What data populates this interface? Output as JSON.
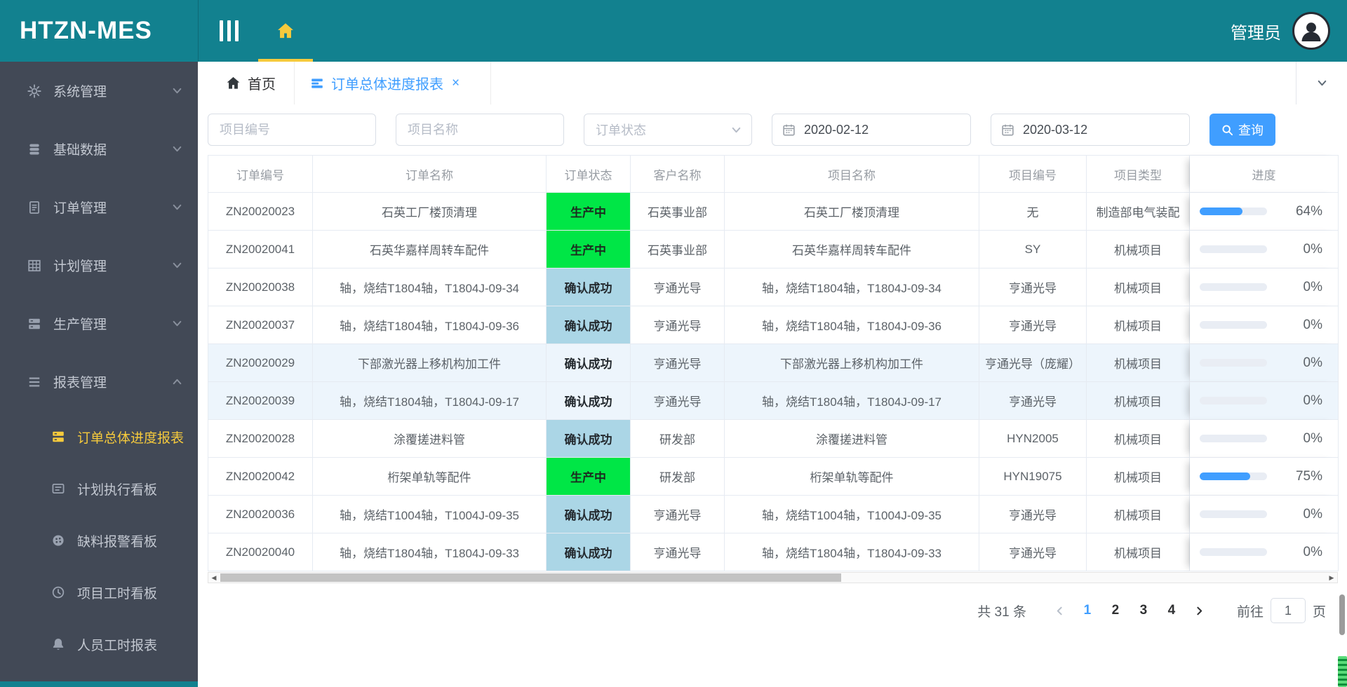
{
  "app": {
    "title": "HTZN-MES",
    "user": "管理员"
  },
  "colors": {
    "teal": "#12818f",
    "sidebar_bg": "#424956",
    "accent_blue": "#409eff",
    "active_yellow": "#f6ca3c",
    "status_green": "#00e646",
    "status_blue": "#abd6e6"
  },
  "sidebar": {
    "menu": [
      {
        "id": "system",
        "label": "系统管理",
        "icon": "gear-icon"
      },
      {
        "id": "base-data",
        "label": "基础数据",
        "icon": "database-icon"
      },
      {
        "id": "orders",
        "label": "订单管理",
        "icon": "document-icon"
      },
      {
        "id": "plans",
        "label": "计划管理",
        "icon": "grid-icon"
      },
      {
        "id": "production",
        "label": "生产管理",
        "icon": "server-icon"
      },
      {
        "id": "reports",
        "label": "报表管理",
        "icon": "list-icon",
        "expanded": true
      }
    ],
    "submenu": [
      {
        "id": "order-progress-report",
        "label": "订单总体进度报表",
        "icon": "server-icon",
        "active": true
      },
      {
        "id": "plan-execution-board",
        "label": "计划执行看板",
        "icon": "board-icon"
      },
      {
        "id": "shortage-alarm-board",
        "label": "缺料报警看板",
        "icon": "pie-icon"
      },
      {
        "id": "project-hours-board",
        "label": "项目工时看板",
        "icon": "clock-icon"
      },
      {
        "id": "personnel-hours-report",
        "label": "人员工时报表",
        "icon": "bell-icon"
      }
    ]
  },
  "tabs": [
    {
      "label": "首页",
      "icon": "home-icon"
    },
    {
      "label": "订单总体进度报表",
      "icon": "bars-icon",
      "active": true,
      "closable": true
    }
  ],
  "filters": {
    "project_no_placeholder": "项目编号",
    "project_name_placeholder": "项目名称",
    "order_status_placeholder": "订单状态",
    "date_from": "2020-02-12",
    "date_to": "2020-03-12",
    "search_label": "查询"
  },
  "table": {
    "columns": [
      "订单编号",
      "订单名称",
      "订单状态",
      "客户名称",
      "项目名称",
      "项目编号",
      "项目类型",
      "进度"
    ],
    "rows": [
      {
        "order_no": "ZN20020023",
        "order_name": "石英工厂楼顶清理",
        "status": "生产中",
        "status_type": "green",
        "customer": "石英事业部",
        "project_name": "石英工厂楼顶清理",
        "project_no": "无",
        "project_type": "制造部电气装配",
        "progress": 64
      },
      {
        "order_no": "ZN20020041",
        "order_name": "石英华嘉样周转车配件",
        "status": "生产中",
        "status_type": "green",
        "customer": "石英事业部",
        "project_name": "石英华嘉样周转车配件",
        "project_no": "SY",
        "project_type": "机械项目",
        "progress": 0
      },
      {
        "order_no": "ZN20020038",
        "order_name": "轴，烧结T1804轴，T1804J-09-34",
        "status": "确认成功",
        "status_type": "blue",
        "customer": "亨通光导",
        "project_name": "轴，烧结T1804轴，T1804J-09-34",
        "project_no": "亨通光导",
        "project_type": "机械项目",
        "progress": 0
      },
      {
        "order_no": "ZN20020037",
        "order_name": "轴，烧结T1804轴，T1804J-09-36",
        "status": "确认成功",
        "status_type": "blue",
        "customer": "亨通光导",
        "project_name": "轴，烧结T1804轴，T1804J-09-36",
        "project_no": "亨通光导",
        "project_type": "机械项目",
        "progress": 0
      },
      {
        "order_no": "ZN20020029",
        "order_name": "下部激光器上移机构加工件",
        "status": "确认成功",
        "status_type": "blue",
        "customer": "亨通光导",
        "project_name": "下部激光器上移机构加工件",
        "project_no": "亨通光导（庞耀）",
        "project_type": "机械项目",
        "progress": 0,
        "tinted": true
      },
      {
        "order_no": "ZN20020039",
        "order_name": "轴，烧结T1804轴，T1804J-09-17",
        "status": "确认成功",
        "status_type": "blue",
        "customer": "亨通光导",
        "project_name": "轴，烧结T1804轴，T1804J-09-17",
        "project_no": "亨通光导",
        "project_type": "机械项目",
        "progress": 0,
        "tinted": true
      },
      {
        "order_no": "ZN20020028",
        "order_name": "涂覆搓进料管",
        "status": "确认成功",
        "status_type": "blue",
        "customer": "研发部",
        "project_name": "涂覆搓进料管",
        "project_no": "HYN2005",
        "project_type": "机械项目",
        "progress": 0
      },
      {
        "order_no": "ZN20020042",
        "order_name": "桁架单轨等配件",
        "status": "生产中",
        "status_type": "green",
        "customer": "研发部",
        "project_name": "桁架单轨等配件",
        "project_no": "HYN19075",
        "project_type": "机械项目",
        "progress": 75
      },
      {
        "order_no": "ZN20020036",
        "order_name": "轴，烧结T1004轴，T1004J-09-35",
        "status": "确认成功",
        "status_type": "blue",
        "customer": "亨通光导",
        "project_name": "轴，烧结T1004轴，T1004J-09-35",
        "project_no": "亨通光导",
        "project_type": "机械项目",
        "progress": 0
      },
      {
        "order_no": "ZN20020040",
        "order_name": "轴，烧结T1804轴，T1804J-09-33",
        "status": "确认成功",
        "status_type": "blue",
        "customer": "亨通光导",
        "project_name": "轴，烧结T1804轴，T1804J-09-33",
        "project_no": "亨通光导",
        "project_type": "机械项目",
        "progress": 0
      }
    ]
  },
  "pagination": {
    "total_text": "共 31 条",
    "pages": [
      "1",
      "2",
      "3",
      "4"
    ],
    "active_page": "1",
    "goto_label": "前往",
    "goto_value": "1",
    "page_suffix": "页"
  }
}
